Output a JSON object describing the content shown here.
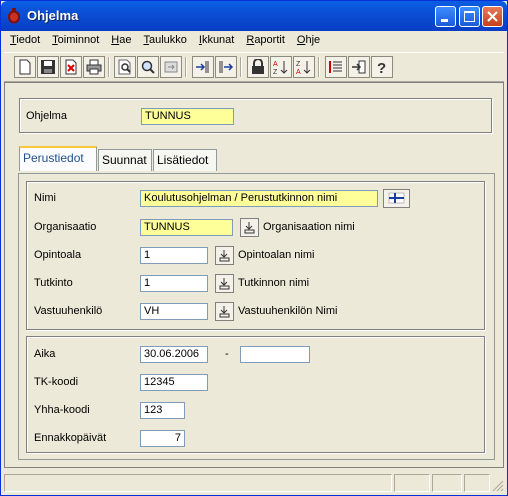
{
  "window": {
    "title": "Ohjelma"
  },
  "menu": [
    "Tiedot",
    "Toiminnot",
    "Hae",
    "Taulukko",
    "Ikkunat",
    "Raportit",
    "Ohje"
  ],
  "header": {
    "label": "Ohjelma",
    "value": "TUNNUS"
  },
  "tabs": [
    "Perustiedot",
    "Suunnat",
    "Lisätiedot"
  ],
  "basic": {
    "nimi_label": "Nimi",
    "nimi_value": "Koulutusohjelman / Perustutkinnon nimi",
    "org_label": "Organisaatio",
    "org_value": "TUNNUS",
    "org_name": "Organisaation nimi",
    "opintoala_label": "Opintoala",
    "opintoala_value": "1",
    "opintoala_name": "Opintoalan nimi",
    "tutkinto_label": "Tutkinto",
    "tutkinto_value": "1",
    "tutkinto_name": "Tutkinnon nimi",
    "vastuu_label": "Vastuuhenkilö",
    "vastuu_value": "VH",
    "vastuu_name": "Vastuuhenkilön Nimi"
  },
  "extra": {
    "aika_label": "Aika",
    "aika_start": "30.06.2006",
    "aika_sep": "-",
    "aika_end": "",
    "tk_label": "TK-koodi",
    "tk_value": "12345",
    "yhha_label": "Yhha-koodi",
    "yhha_value": "123",
    "ennakko_label": "Ennakkopäivät",
    "ennakko_value": "7"
  },
  "colors": {
    "title_blue": "#0b4fd6",
    "highlight_yellow": "#ffff99",
    "tab_accent": "#ffc83c"
  }
}
